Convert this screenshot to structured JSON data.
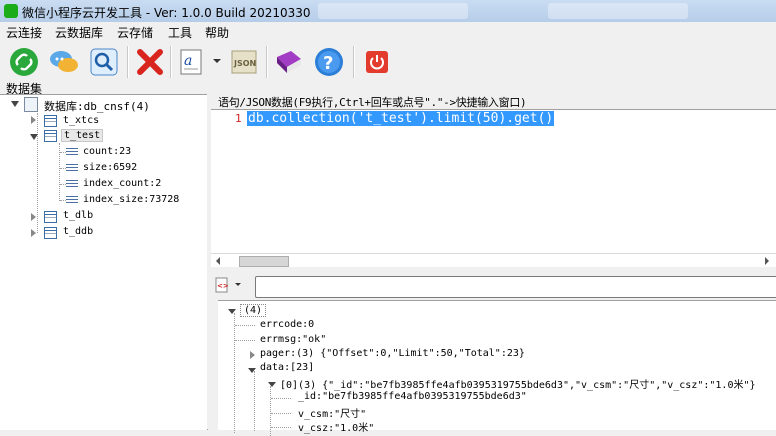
{
  "window": {
    "title": "微信小程序云开发工具 - Ver: 1.0.0 Build 20210330"
  },
  "menu": [
    "云连接",
    "云数据库",
    "云存储",
    "工具",
    "帮助"
  ],
  "toolbar": {
    "icons": [
      "connect-icon",
      "chat-icon",
      "search-icon",
      "delete-icon",
      "font-icon",
      "json-icon",
      "book-icon",
      "help-icon",
      "power-icon"
    ]
  },
  "left_panel": {
    "label": "数据集",
    "database": "数据库:db_cnsf(4)",
    "collections": [
      {
        "name": "t_xtcs",
        "expanded": false
      },
      {
        "name": "t_test",
        "expanded": true,
        "fields": [
          "count:23",
          "size:6592",
          "index_count:2",
          "index_size:73728"
        ]
      },
      {
        "name": "t_dlb",
        "expanded": false
      },
      {
        "name": "t_ddb",
        "expanded": false
      }
    ]
  },
  "editor": {
    "label": "语句/JSON数据(F9执行,Ctrl+回车或点号\".\"->快捷输入窗口)",
    "line_number": "1",
    "code": "db.collection('t_test').limit(50).get()"
  },
  "results": {
    "root": "(4)",
    "errcode": "errcode:0",
    "errmsg": "errmsg:\"ok\"",
    "pager": "pager:(3) {\"Offset\":0,\"Limit\":50,\"Total\":23}",
    "data": "data:[23]",
    "item0": "[0](3) {\"_id\":\"be7fb3985ffe4afb0395319755bde6d3\",\"v_csm\":\"尺寸\",\"v_csz\":\"1.0米\"}",
    "item0_id": "_id:\"be7fb3985ffe4afb0395319755bde6d3\"",
    "item0_csm": "v_csm:\"尺寸\"",
    "item0_csz": "v_csz:\"1.0米\""
  },
  "colors": {
    "selection": "#3399ff",
    "line_number": "#d02020",
    "titlebar": "#c9dcf2"
  }
}
